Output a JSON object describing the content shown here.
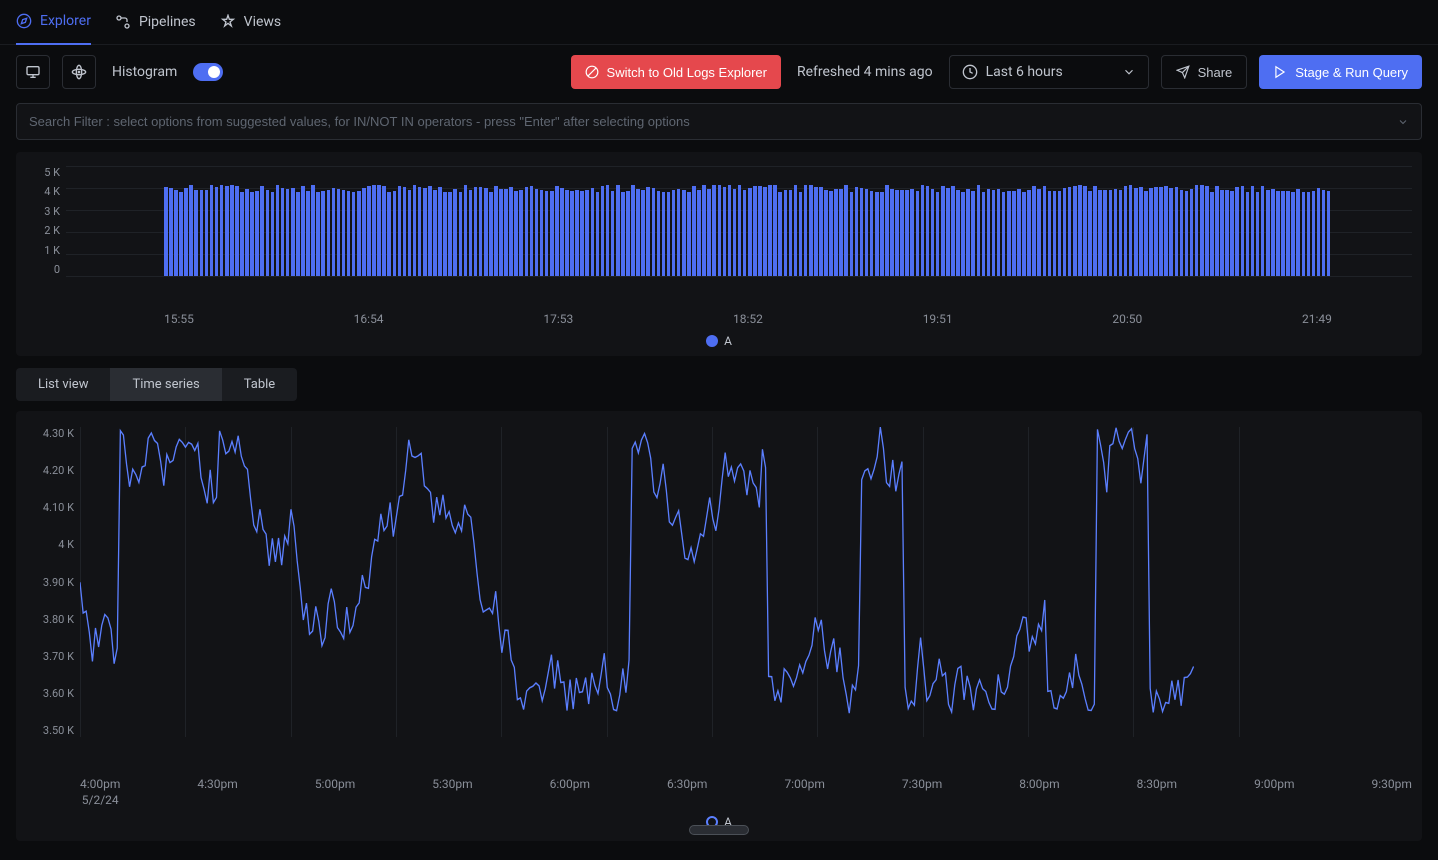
{
  "nav": {
    "explorer": "Explorer",
    "pipelines": "Pipelines",
    "views": "Views"
  },
  "toolbar": {
    "histogram_label": "Histogram",
    "switch_btn": "Switch to Old Logs Explorer",
    "refreshed": "Refreshed 4 mins ago",
    "time_range": "Last 6 hours",
    "share": "Share",
    "run_query": "Stage & Run Query"
  },
  "search": {
    "placeholder": "Search Filter : select options from suggested values, for IN/NOT IN operators - press \"Enter\" after selecting options"
  },
  "view_tabs": {
    "list": "List view",
    "timeseries": "Time series",
    "table": "Table"
  },
  "chart_data": [
    {
      "type": "bar",
      "series_name": "A",
      "y_ticks": [
        "5 K",
        "4 K",
        "3 K",
        "2 K",
        "1 K",
        "0"
      ],
      "x_ticks": [
        "15:55",
        "16:54",
        "17:53",
        "18:52",
        "19:51",
        "20:50",
        "21:49"
      ],
      "ylim": [
        0,
        5000
      ],
      "approx_values_note": "~230 bars fluctuating roughly between 3800 and 4200"
    },
    {
      "type": "line",
      "series_name": "A",
      "y_ticks": [
        "4.30 K",
        "4.20 K",
        "4.10 K",
        "4 K",
        "3.90 K",
        "3.80 K",
        "3.70 K",
        "3.60 K",
        "3.50 K"
      ],
      "ylim": [
        3500,
        4300
      ],
      "x_ticks": [
        "4:00pm",
        "4:30pm",
        "5:00pm",
        "5:30pm",
        "6:00pm",
        "6:30pm",
        "7:00pm",
        "7:30pm",
        "8:00pm",
        "8:30pm",
        "9:00pm",
        "9:30pm"
      ],
      "x_date": "5/2/24"
    }
  ],
  "legend": {
    "a": "A"
  }
}
